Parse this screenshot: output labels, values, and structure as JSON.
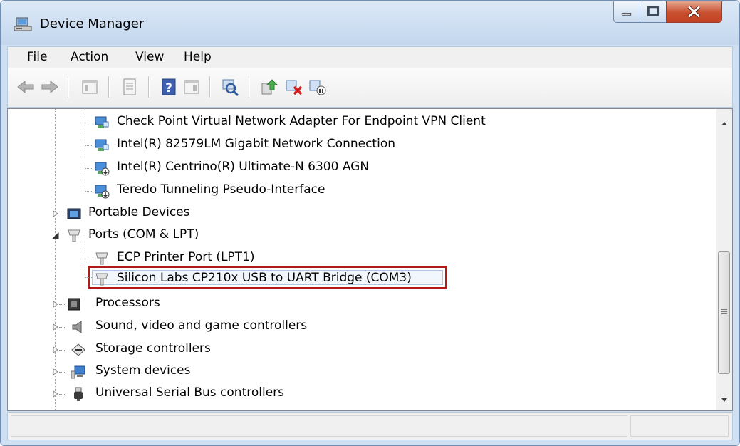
{
  "window": {
    "title": "Device Manager"
  },
  "menu": {
    "items": [
      "File",
      "Action",
      "View",
      "Help"
    ]
  },
  "toolbar": {
    "buttons": [
      "back-icon",
      "forward-icon",
      "show-hide-console-tree-icon",
      "properties-icon",
      "help-icon",
      "action-pane-icon",
      "scan-hardware-changes-icon",
      "update-driver-icon",
      "uninstall-icon",
      "disable-device-icon"
    ]
  },
  "tree": {
    "network_children": [
      "Check Point Virtual Network Adapter For Endpoint VPN Client",
      "Intel(R) 82579LM Gigabit Network Connection",
      "Intel(R) Centrino(R) Ultimate-N 6300 AGN",
      "Teredo Tunneling Pseudo-Interface"
    ],
    "portable_devices": "Portable Devices",
    "ports": "Ports (COM & LPT)",
    "ports_children": [
      "ECP Printer Port (LPT1)",
      "Silicon Labs CP210x USB to UART Bridge (COM3)"
    ],
    "processors": "Processors",
    "sound": "Sound, video and game controllers",
    "storage": "Storage controllers",
    "system": "System devices",
    "usb": "Universal Serial Bus controllers"
  },
  "colors": {
    "highlight_border": "#b01a1a",
    "titlebar": "#c3d7ee"
  }
}
